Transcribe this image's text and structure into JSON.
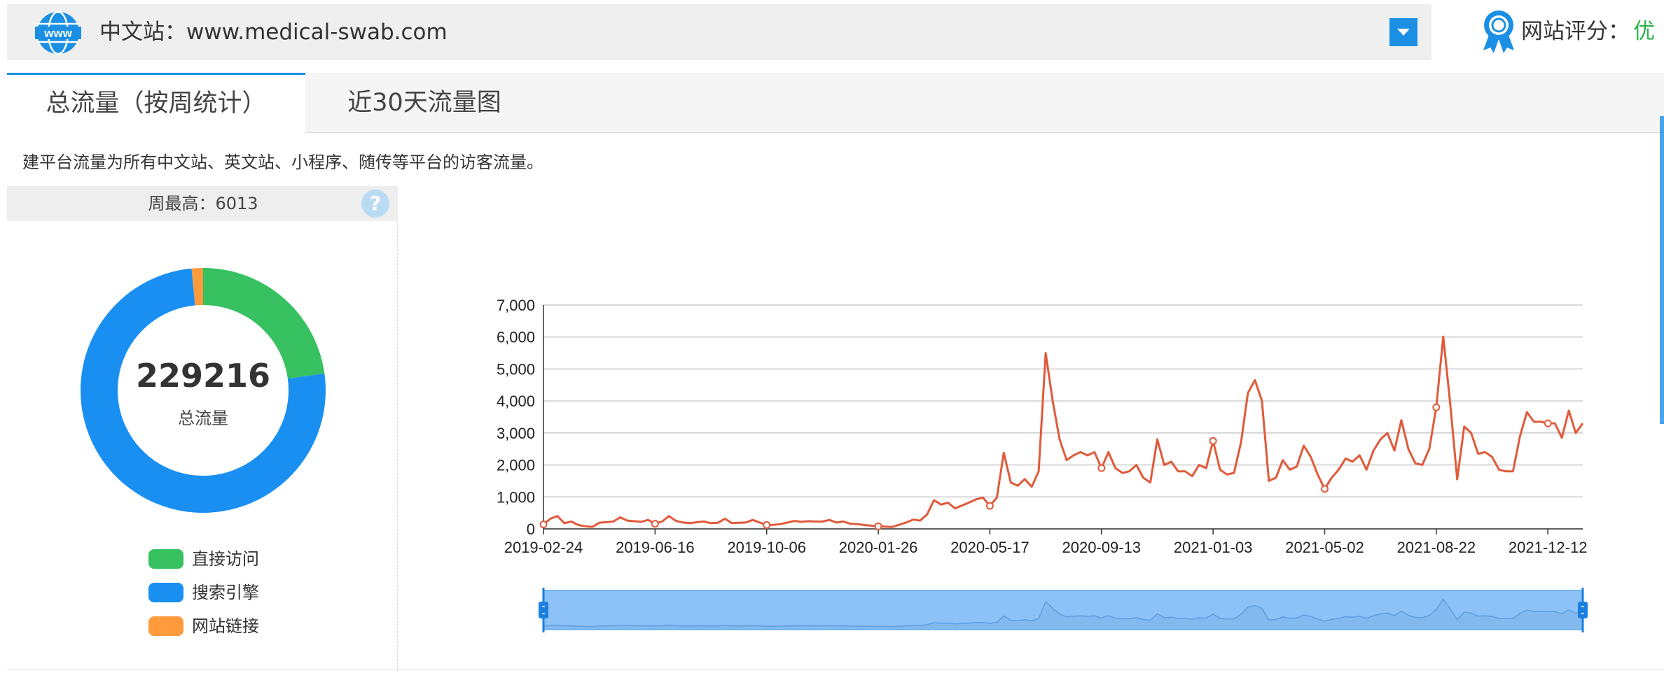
{
  "site": {
    "label": "中文站：www.medical-swab.com",
    "globe_text": "www",
    "icon": "globe-icon"
  },
  "rating": {
    "label": "网站评分：",
    "value": "优",
    "icon": "award-icon"
  },
  "tabs": [
    {
      "label": "总流量（按周统计）",
      "active": true
    },
    {
      "label": "近30天流量图",
      "active": false
    }
  ],
  "note": "建平台流量为所有中文站、英文站、小程序、随传等平台的访客流量。",
  "summary": {
    "weekly_max": "周最高：6013",
    "total_value": "229216",
    "total_label": "总流量",
    "help_symbol": "?"
  },
  "colors": {
    "direct": "#37c161",
    "search": "#1a8ff2",
    "link": "#ff9a3d",
    "line": "#e05a3a",
    "accent": "#1a8fe3",
    "rating_good": "#2db34a"
  },
  "chart_data": [
    {
      "type": "pie",
      "style": "donut",
      "categories": [
        "直接访问",
        "搜索引擎",
        "网站链接"
      ],
      "values": [
        0.228,
        0.757,
        0.015
      ],
      "legend": "bottom"
    },
    {
      "type": "line",
      "xlabel": "",
      "ylabel": "",
      "ylim": [
        0,
        7000
      ],
      "yticks": [
        "0",
        "1,000",
        "2,000",
        "3,000",
        "4,000",
        "5,000",
        "6,000",
        "7,000"
      ],
      "xtick_labels": [
        "2019-02-24",
        "2019-06-16",
        "2019-10-06",
        "2020-01-26",
        "2020-05-17",
        "2020-09-13",
        "2021-01-03",
        "2021-05-02",
        "2021-08-22",
        "2021-12-12"
      ],
      "x_start": "2019-02-24",
      "x_end": "2021-12-26",
      "grid": true,
      "values": [
        140,
        320,
        400,
        180,
        230,
        120,
        80,
        60,
        190,
        210,
        230,
        360,
        260,
        240,
        220,
        280,
        160,
        230,
        400,
        250,
        200,
        180,
        210,
        230,
        180,
        190,
        320,
        180,
        190,
        200,
        280,
        200,
        120,
        130,
        150,
        200,
        250,
        220,
        240,
        230,
        230,
        280,
        200,
        230,
        160,
        150,
        120,
        100,
        80,
        70,
        60,
        130,
        200,
        290,
        260,
        450,
        900,
        760,
        820,
        640,
        730,
        820,
        920,
        980,
        720,
        980,
        2380,
        1450,
        1350,
        1560,
        1320,
        1800,
        5500,
        4000,
        2800,
        2150,
        2300,
        2400,
        2300,
        2400,
        1900,
        2400,
        1900,
        1750,
        1800,
        2000,
        1600,
        1450,
        2800,
        2000,
        2100,
        1800,
        1800,
        1650,
        2000,
        1900,
        2750,
        1850,
        1700,
        1750,
        2700,
        4250,
        4650,
        4000,
        1500,
        1600,
        2150,
        1850,
        1950,
        2600,
        2250,
        1700,
        1250,
        1600,
        1850,
        2200,
        2100,
        2300,
        1850,
        2450,
        2800,
        3000,
        2450,
        3400,
        2500,
        2050,
        2000,
        2500,
        3800,
        6013,
        3900,
        1550,
        3200,
        3000,
        2350,
        2400,
        2250,
        1850,
        1800,
        1800,
        2900,
        3650,
        3350,
        3350,
        3300,
        3300,
        2850,
        3700,
        3000,
        3300
      ]
    }
  ]
}
